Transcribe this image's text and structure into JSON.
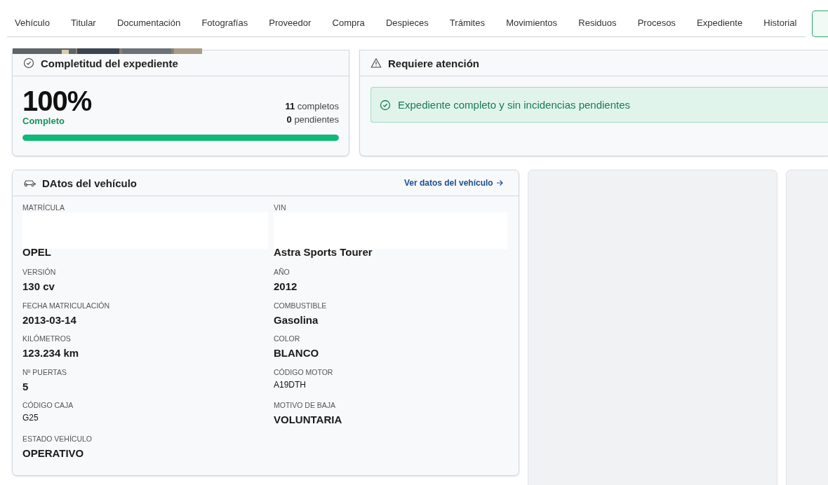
{
  "tabs": [
    {
      "label": "Vehículo",
      "selected": false
    },
    {
      "label": "Titular",
      "selected": false
    },
    {
      "label": "Documentación",
      "selected": false
    },
    {
      "label": "Fotografías",
      "selected": false
    },
    {
      "label": "Proveedor",
      "selected": false
    },
    {
      "label": "Compra",
      "selected": false
    },
    {
      "label": "Despieces",
      "selected": false
    },
    {
      "label": "Trámites",
      "selected": false
    },
    {
      "label": "Movimientos",
      "selected": false
    },
    {
      "label": "Residuos",
      "selected": false
    },
    {
      "label": "Procesos",
      "selected": false
    },
    {
      "label": "Expediente",
      "selected": false
    },
    {
      "label": "Historial",
      "selected": false
    }
  ],
  "completeness": {
    "title": "Completitud del expediente",
    "percent": "100%",
    "status": "Completo",
    "complete_count": "11",
    "complete_label": "completos",
    "pending_count": "0",
    "pending_label": "pendientes",
    "level": 1
  },
  "attention": {
    "title": "Requiere atención",
    "message": "Expediente completo y sin incidencias pendientes"
  },
  "vehicle": {
    "title": "DAtos del vehículo",
    "link": "Ver datos del vehículo",
    "fields": [
      {
        "label": "MATRÍCULA",
        "redacted": true
      },
      {
        "label": "VIN",
        "redacted": true
      },
      {
        "value": "OPEL",
        "kind": "strong"
      },
      {
        "value": "Astra Sports Tourer",
        "kind": "strong"
      },
      {
        "label": "VERSIÓN",
        "value": "130 cv",
        "kind": "strong"
      },
      {
        "label": "AÑO",
        "value": "2012",
        "kind": "strong"
      },
      {
        "label": "FECHA MATRICULACIÓN",
        "value": "2013-03-14",
        "kind": "strong"
      },
      {
        "label": "COMBUSTIBLE",
        "value": "Gasolina",
        "kind": "strong"
      },
      {
        "label": "KILÓMETROS",
        "value": "123.234 km",
        "kind": "strong"
      },
      {
        "label": "COLOR",
        "value": "BLANCO",
        "kind": "strong"
      },
      {
        "label": "Nº PUERTAS",
        "value": "5",
        "kind": "strong"
      },
      {
        "label": "CÓDIGO MOTOR",
        "value": "A19DTH",
        "kind": "code"
      },
      {
        "label": "CÓDIGO CAJA",
        "value": "G25",
        "kind": "code"
      },
      {
        "label": "MOTIVO DE BAJA",
        "value": "VOLUNTARIA",
        "kind": "strong"
      },
      {
        "label": "ESTADO VEHÍCULO",
        "value": "OPERATIVO",
        "kind": "strong"
      }
    ]
  }
}
